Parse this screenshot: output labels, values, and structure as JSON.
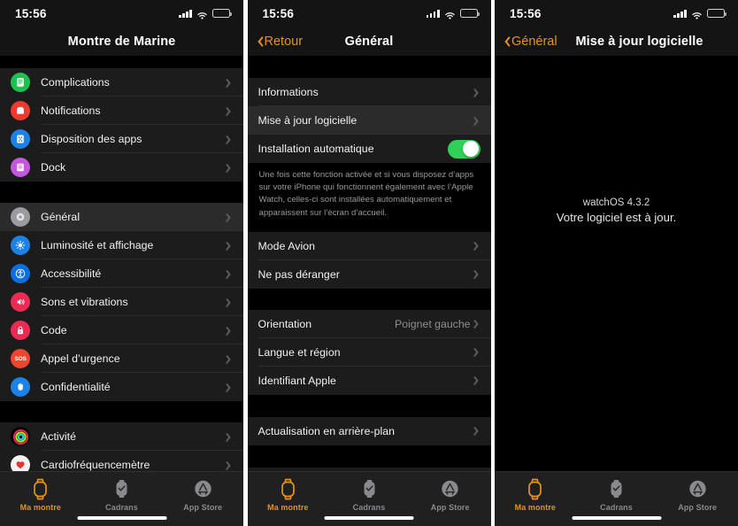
{
  "status_bar": {
    "time": "15:56",
    "signal_icon": "cellular-bars-icon",
    "wifi_icon": "wifi-icon",
    "battery_icon": "battery-icon"
  },
  "tab_bar": {
    "tabs": [
      {
        "label": "Ma montre",
        "icon": "watch-outline-icon",
        "active": true
      },
      {
        "label": "Cadrans",
        "icon": "watch-face-icon",
        "active": false
      },
      {
        "label": "App Store",
        "icon": "app-store-icon",
        "active": false
      }
    ]
  },
  "panel1": {
    "nav": {
      "title": "Montre de Marine"
    },
    "groups": [
      {
        "rows": [
          {
            "label": "Complications",
            "icon": "complications-icon",
            "accessory": "chevron"
          },
          {
            "label": "Notifications",
            "icon": "notifications-icon",
            "accessory": "chevron"
          },
          {
            "label": "Disposition des apps",
            "icon": "app-layout-icon",
            "accessory": "chevron"
          },
          {
            "label": "Dock",
            "icon": "dock-icon",
            "accessory": "chevron"
          }
        ]
      },
      {
        "rows": [
          {
            "label": "Général",
            "icon": "gear-icon",
            "accessory": "chevron",
            "highlighted": true
          },
          {
            "label": "Luminosité et affichage",
            "icon": "brightness-icon",
            "accessory": "chevron"
          },
          {
            "label": "Accessibilité",
            "icon": "accessibility-icon",
            "accessory": "chevron"
          },
          {
            "label": "Sons et vibrations",
            "icon": "speaker-icon",
            "accessory": "chevron"
          },
          {
            "label": "Code",
            "icon": "lock-icon",
            "accessory": "chevron"
          },
          {
            "label": "Appel d’urgence",
            "icon": "sos-icon",
            "accessory": "chevron"
          },
          {
            "label": "Confidentialité",
            "icon": "hand-privacy-icon",
            "accessory": "chevron"
          }
        ]
      },
      {
        "rows": [
          {
            "label": "Activité",
            "icon": "activity-rings-icon",
            "accessory": "chevron"
          },
          {
            "label": "Cardiofréquencemètre",
            "icon": "heart-rate-icon",
            "accessory": "chevron",
            "clipped": true
          }
        ]
      }
    ]
  },
  "panel2": {
    "nav": {
      "back_label": "Retour",
      "title": "Général"
    },
    "groups": [
      {
        "rows": [
          {
            "label": "Informations",
            "accessory": "chevron"
          },
          {
            "label": "Mise à jour logicielle",
            "accessory": "chevron",
            "highlighted": true
          },
          {
            "label": "Installation automatique",
            "accessory": "toggle",
            "toggle_on": true
          }
        ],
        "footnote": "Une fois cette fonction activée et si vous disposez d’apps sur votre iPhone qui fonctionnent également avec l’Apple Watch, celles-ci sont installées automatiquement et apparaissent sur l’écran d’accueil."
      },
      {
        "rows": [
          {
            "label": "Mode Avion",
            "accessory": "chevron"
          },
          {
            "label": "Ne pas déranger",
            "accessory": "chevron"
          }
        ]
      },
      {
        "rows": [
          {
            "label": "Orientation",
            "value": "Poignet gauche",
            "accessory": "chevron"
          },
          {
            "label": "Langue et région",
            "accessory": "chevron"
          },
          {
            "label": "Identifiant Apple",
            "accessory": "chevron"
          }
        ]
      },
      {
        "rows": [
          {
            "label": "Actualisation en arrière-plan",
            "accessory": "chevron"
          }
        ]
      },
      {
        "rows": [
          {
            "label": "",
            "accessory": "toggle",
            "toggle_on": true,
            "clipped": true
          }
        ]
      }
    ]
  },
  "panel3": {
    "nav": {
      "back_label": "Général",
      "title": "Mise à jour logicielle"
    },
    "version": "watchOS 4.3.2",
    "message": "Votre logiciel est à jour."
  },
  "colors": {
    "accent": "#E8921A",
    "toggle_on": "#30D158",
    "row_bg": "#1C1C1C",
    "row_bg_highlight": "#2B2B2B",
    "screen_bg": "#000000"
  }
}
